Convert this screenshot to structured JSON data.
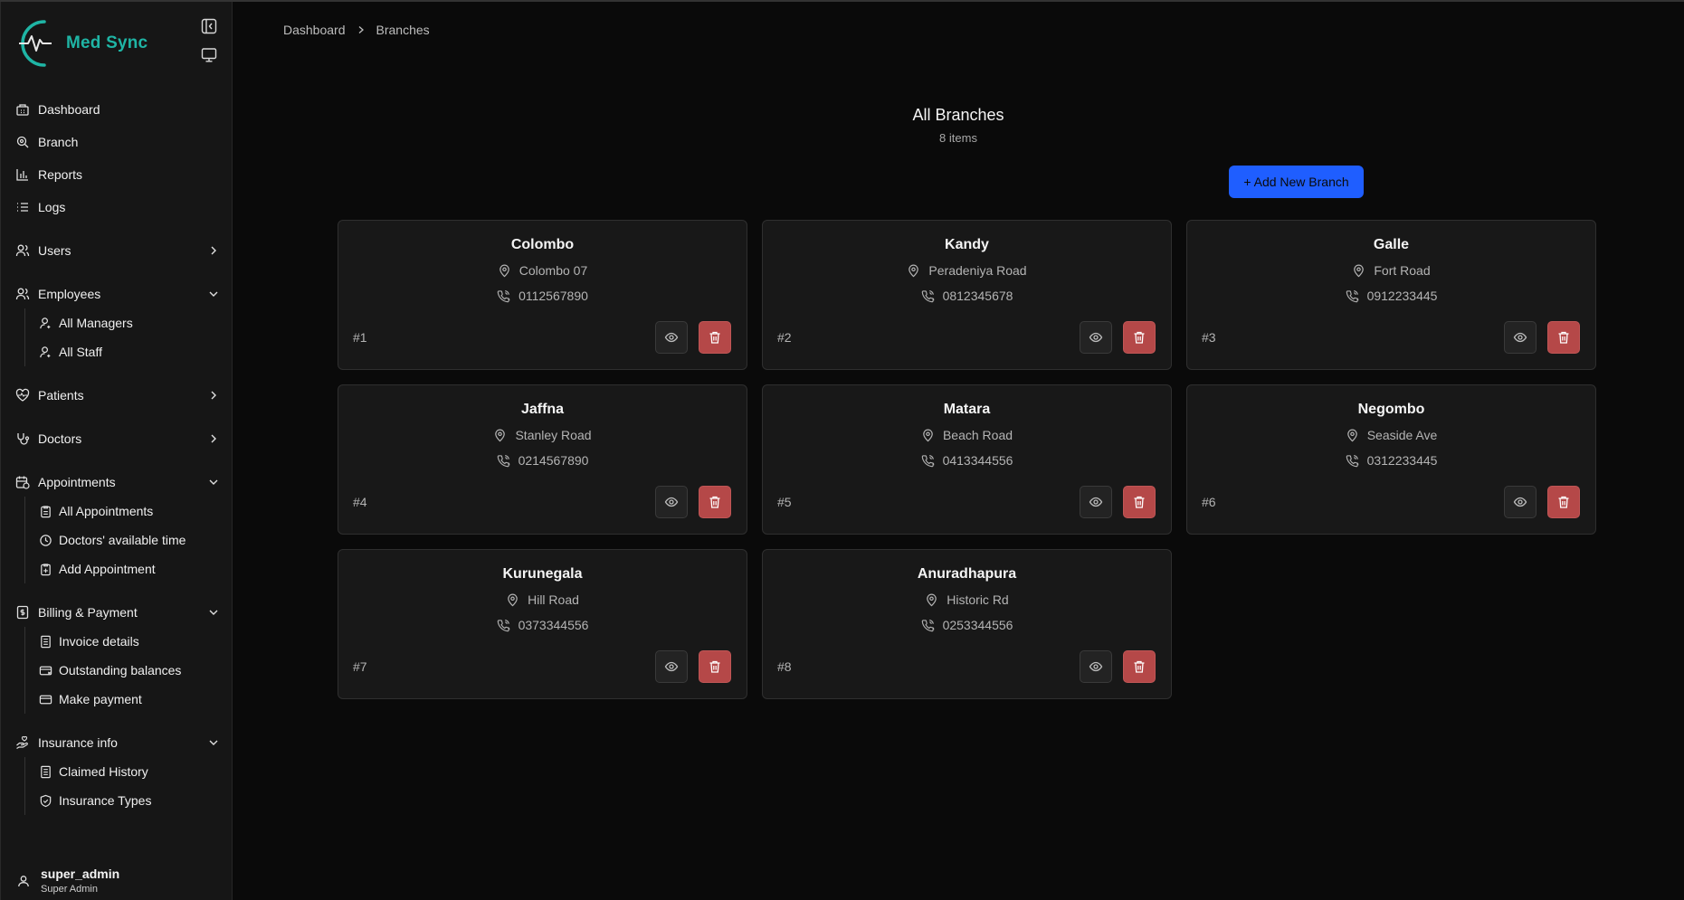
{
  "brand": {
    "name": "Med Sync",
    "accent": "#1fb5a5"
  },
  "sidebar": {
    "nav": [
      {
        "label": "Dashboard",
        "icon": "dashboard-icon"
      },
      {
        "label": "Branch",
        "icon": "branch-icon"
      },
      {
        "label": "Reports",
        "icon": "chart-icon"
      },
      {
        "label": "Logs",
        "icon": "list-icon"
      }
    ],
    "users": {
      "label": "Users",
      "icon": "users-icon"
    },
    "employees": {
      "label": "Employees",
      "icon": "employees-icon",
      "items": [
        {
          "label": "All Managers"
        },
        {
          "label": "All Staff"
        }
      ]
    },
    "patients": {
      "label": "Patients",
      "icon": "heart-icon"
    },
    "doctors": {
      "label": "Doctors",
      "icon": "stethoscope-icon"
    },
    "appointments": {
      "label": "Appointments",
      "icon": "calendar-icon",
      "items": [
        {
          "label": "All Appointments"
        },
        {
          "label": "Doctors' available time"
        },
        {
          "label": "Add Appointment"
        }
      ]
    },
    "billing": {
      "label": "Billing & Payment",
      "icon": "receipt-icon",
      "items": [
        {
          "label": "Invoice details"
        },
        {
          "label": "Outstanding balances"
        },
        {
          "label": "Make payment"
        }
      ]
    },
    "insurance": {
      "label": "Insurance info",
      "icon": "insurance-icon",
      "items": [
        {
          "label": "Claimed History"
        },
        {
          "label": "Insurance Types"
        }
      ]
    },
    "user": {
      "name": "super_admin",
      "role": "Super Admin"
    }
  },
  "breadcrumb": {
    "home": "Dashboard",
    "current": "Branches"
  },
  "page": {
    "title": "All Branches",
    "count": "8 items",
    "add_label": "+ Add New Branch",
    "add_color": "#1f5eff"
  },
  "branches": [
    {
      "name": "Colombo",
      "address": "Colombo 07",
      "phone": "0112567890",
      "num": "#1"
    },
    {
      "name": "Kandy",
      "address": "Peradeniya Road",
      "phone": "0812345678",
      "num": "#2"
    },
    {
      "name": "Galle",
      "address": "Fort Road",
      "phone": "0912233445",
      "num": "#3"
    },
    {
      "name": "Jaffna",
      "address": "Stanley Road",
      "phone": "0214567890",
      "num": "#4"
    },
    {
      "name": "Matara",
      "address": "Beach Road",
      "phone": "0413344556",
      "num": "#5"
    },
    {
      "name": "Negombo",
      "address": "Seaside Ave",
      "phone": "0312233445",
      "num": "#6"
    },
    {
      "name": "Kurunegala",
      "address": "Hill Road",
      "phone": "0373344556",
      "num": "#7"
    },
    {
      "name": "Anuradhapura",
      "address": "Historic Rd",
      "phone": "0253344556",
      "num": "#8"
    }
  ],
  "colors": {
    "delete": "#b54848",
    "card_bg": "#181818"
  }
}
